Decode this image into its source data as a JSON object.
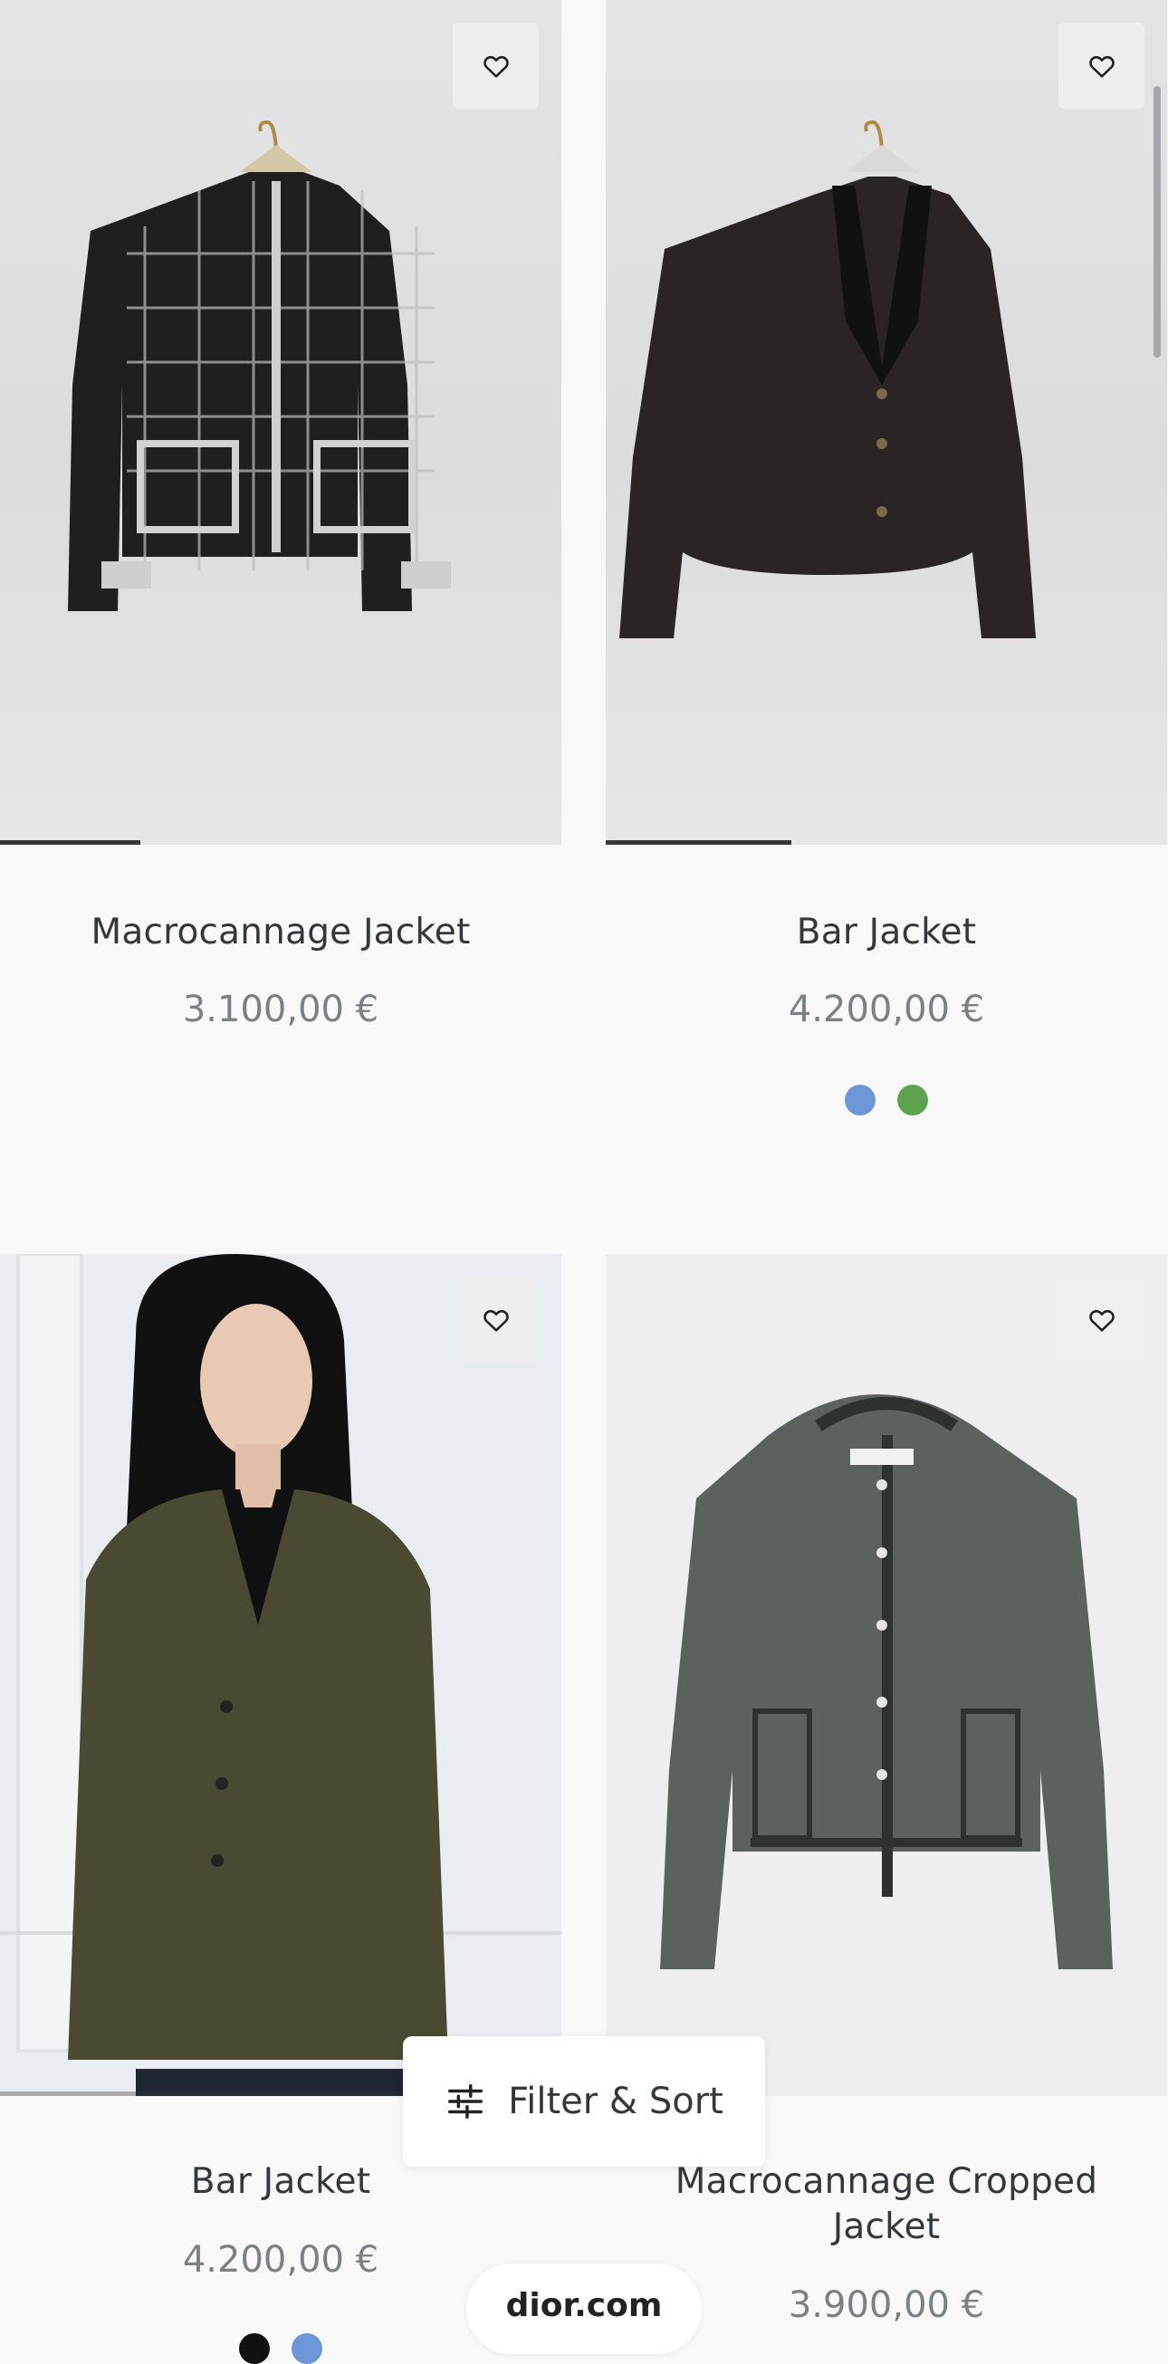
{
  "products": [
    {
      "name": "Macrocannage Jacket",
      "price": "3.100,00 €",
      "progress": 0.25
    },
    {
      "name": "Bar Jacket",
      "price": "4.200,00 €",
      "progress": 0.33,
      "swatches": [
        "#6c96d8",
        "#5ea24f"
      ]
    },
    {
      "name": "Bar Jacket",
      "price": "4.200,00 €",
      "swatches": [
        "#111111",
        "#6c96d8"
      ]
    },
    {
      "name": "Macrocannage Cropped Jacket",
      "price": "3.900,00 €"
    }
  ],
  "icons": {
    "favorite": "heart-icon",
    "filter": "sliders-icon"
  },
  "filter_sort": {
    "label": "Filter & Sort"
  },
  "browser": {
    "url": "dior.com"
  }
}
